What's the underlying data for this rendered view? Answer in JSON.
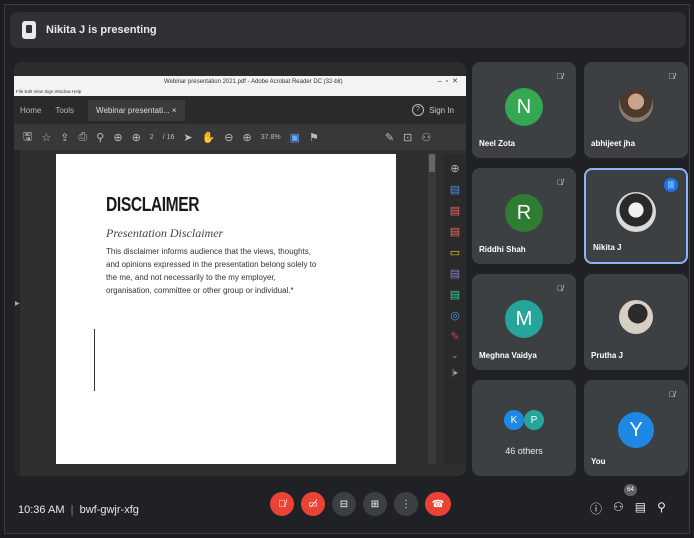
{
  "presenting_bar": {
    "text": "Nikita J is presenting",
    "icon": "presentation-icon"
  },
  "acrobat": {
    "title": "Webinar presentation 2021.pdf - Adobe Acrobat Reader DC (32-bit)",
    "menu": "File   Edit   View   Sign   Window   Help",
    "tabs": [
      "Home",
      "Tools",
      "Webinar presentati...  ×"
    ],
    "sign_in": "Sign In",
    "page_current": "2",
    "page_total": "/ 16",
    "zoom": "37.8%"
  },
  "slide": {
    "title": "DISCLAIMER",
    "subtitle": "Presentation Disclaimer",
    "body": "This disclaimer informs audience that the views, thoughts, and opinions expressed in the presentation belong solely to the me, and not necessarily to the my employer, organisation, committee or other group or individual.*"
  },
  "participants": [
    {
      "name": "Neel Zota",
      "initial": "N",
      "color": "#34a853",
      "muted": true
    },
    {
      "name": "abhijeet jha",
      "initial": "",
      "color": "#6b5a4e",
      "muted": true
    },
    {
      "name": "Riddhi Shah",
      "initial": "R",
      "color": "#2e7d32",
      "muted": true
    },
    {
      "name": "Nikita J",
      "initial": "",
      "color": "#cfcfcf",
      "muted": false
    },
    {
      "name": "Meghna Vaidya",
      "initial": "M",
      "color": "#26a69a",
      "muted": true
    },
    {
      "name": "Prutha J",
      "initial": "",
      "color": "#b0a090",
      "muted": false
    },
    {
      "name": "46 others",
      "initial": "",
      "color": "",
      "muted": false
    },
    {
      "name": "You",
      "initial": "Y",
      "color": "#1e88e5",
      "muted": true
    }
  ],
  "others_avatars": [
    {
      "letter": "K",
      "color": "#1e88e5"
    },
    {
      "letter": "P",
      "color": "#26a69a"
    }
  ],
  "bottom": {
    "time": "10:36 AM",
    "separator": "|",
    "meeting_code": "bwf-gwjr-xfg",
    "participant_count": "64"
  }
}
